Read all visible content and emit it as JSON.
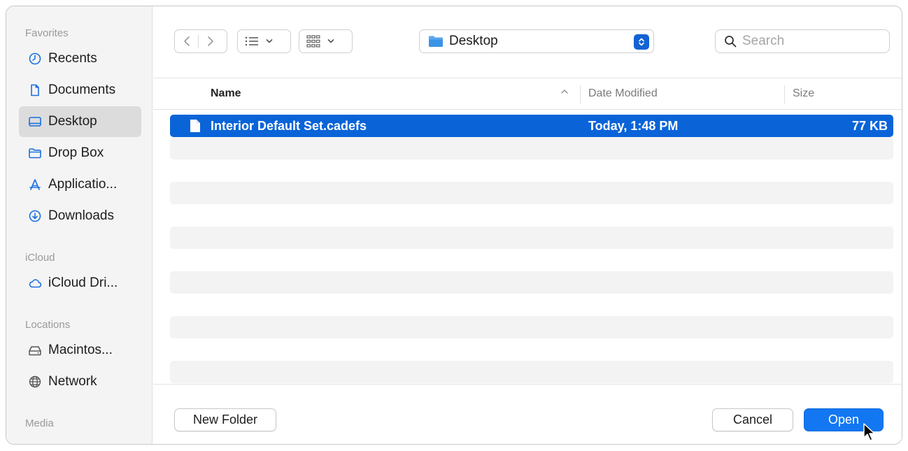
{
  "sidebar": {
    "sections": [
      {
        "title": "Favorites"
      },
      {
        "title": "iCloud"
      },
      {
        "title": "Locations"
      },
      {
        "title": "Media"
      }
    ],
    "items": [
      {
        "label": "Recents",
        "icon": "clock-icon"
      },
      {
        "label": "Documents",
        "icon": "document-icon"
      },
      {
        "label": "Desktop",
        "icon": "desktop-icon",
        "selected": true
      },
      {
        "label": "Drop Box",
        "icon": "folder-icon"
      },
      {
        "label": "Applicatio...",
        "icon": "applications-icon"
      },
      {
        "label": "Downloads",
        "icon": "download-icon"
      },
      {
        "label": "iCloud Dri...",
        "icon": "cloud-icon"
      },
      {
        "label": "Macintos...",
        "icon": "hard-drive-icon"
      },
      {
        "label": "Network",
        "icon": "globe-icon"
      }
    ]
  },
  "toolbar": {
    "path_label": "Desktop",
    "search_placeholder": "Search"
  },
  "table": {
    "columns": {
      "name": "Name",
      "date": "Date Modified",
      "size": "Size"
    },
    "rows": [
      {
        "name": "Interior Default Set.cadefs",
        "date": "Today, 1:48 PM",
        "size": "77 KB"
      }
    ]
  },
  "footer": {
    "new_folder": "New Folder",
    "cancel": "Cancel",
    "open": "Open"
  },
  "colors": {
    "accent": "#1377f2",
    "selection": "#0a64d8"
  }
}
